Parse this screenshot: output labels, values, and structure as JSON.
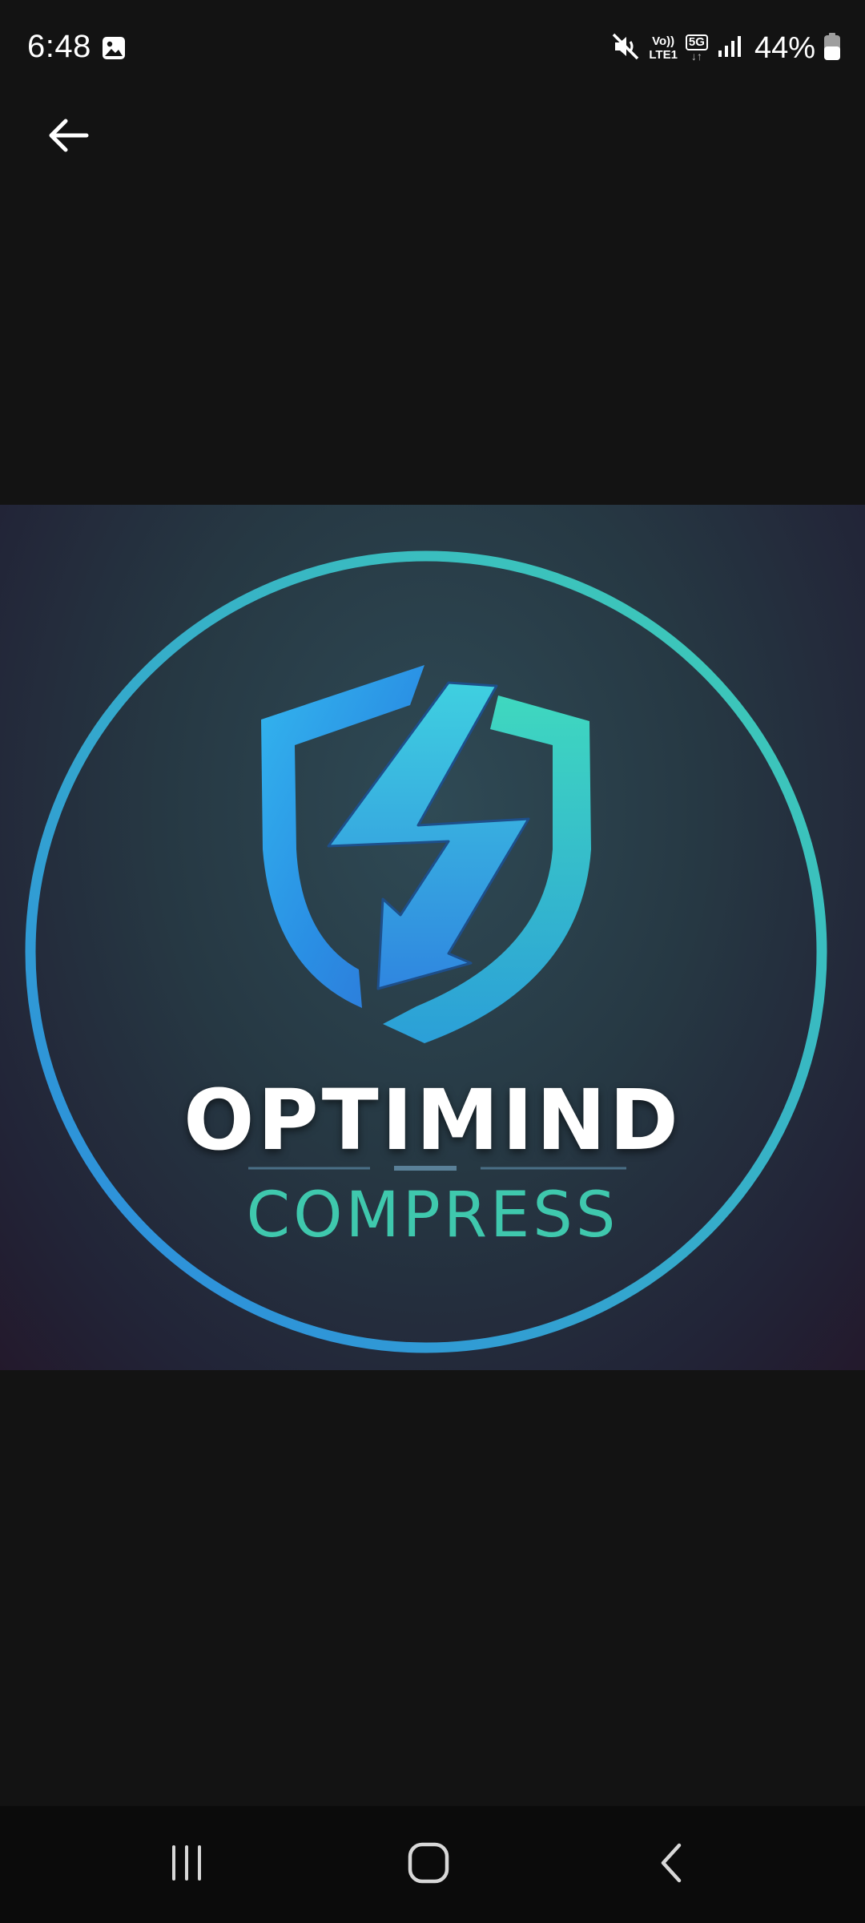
{
  "status_bar": {
    "time": "6:48",
    "volte_top": "Vo))",
    "volte_bottom": "LTE1",
    "network": "5G",
    "network_arrows": "↓↑",
    "battery": "44%"
  },
  "logo": {
    "title": "OPTIMIND",
    "subtitle": "COMPRESS"
  },
  "colors": {
    "background": "#131313",
    "ring_gradient_start": "#2b88e0",
    "ring_gradient_end": "#3fd0b4",
    "subtitle": "#3fc8ad"
  },
  "icons": {
    "back": "arrow-left-icon",
    "gallery": "image-icon",
    "mute": "mute-icon",
    "signal": "signal-icon",
    "battery": "battery-icon",
    "recents": "recents-icon",
    "home": "home-icon",
    "nav_back": "chevron-left-icon"
  }
}
